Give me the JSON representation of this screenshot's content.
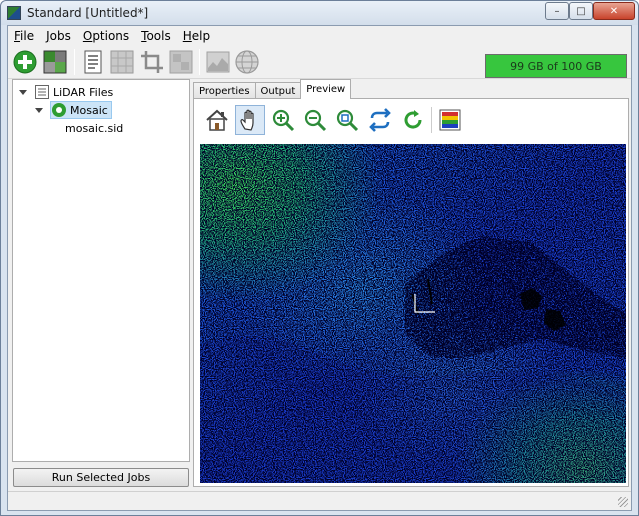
{
  "window": {
    "title": "Standard [Untitled*]",
    "buttons": {
      "minimize": "–",
      "maximize": "□",
      "close": "✕"
    }
  },
  "menubar": {
    "items": [
      {
        "label": "File",
        "accel": "F",
        "rest": "ile"
      },
      {
        "label": "Jobs",
        "accel": "J",
        "rest": "obs"
      },
      {
        "label": "Options",
        "accel": "O",
        "rest": "ptions"
      },
      {
        "label": "Tools",
        "accel": "T",
        "rest": "ools"
      },
      {
        "label": "Help",
        "accel": "H",
        "rest": "elp"
      }
    ]
  },
  "toolbar": {
    "icons": [
      "add-icon",
      "mosaic-icon",
      "document-icon",
      "grid-icon",
      "crop-icon",
      "tiles-icon",
      "chart-icon",
      "globe-icon"
    ],
    "storage": {
      "label": "99 GB of 100 GB",
      "used_fraction": 0.99,
      "color": "#37c63e"
    }
  },
  "tree": {
    "root": {
      "label": "LiDAR Files"
    },
    "child": {
      "label": "Mosaic"
    },
    "leaf": {
      "label": "mosaic.sid"
    }
  },
  "left_panel": {
    "run_button": "Run Selected Jobs"
  },
  "tabs": [
    {
      "label": "Properties",
      "active": false
    },
    {
      "label": "Output",
      "active": false
    },
    {
      "label": "Preview",
      "active": true
    }
  ],
  "preview_toolbar": {
    "icons": [
      "home-icon",
      "pan-hand-icon",
      "zoom-in-icon",
      "zoom-out-icon",
      "zoom-fit-icon",
      "swap-icon",
      "refresh-icon",
      "color-ramp-icon"
    ],
    "pressed": "pan-hand-icon"
  },
  "colors": {
    "lidar_blue": "#1a3ed0",
    "lidar_green": "#2fcf55",
    "lidar_cyan": "#1c9ae0",
    "accent_green": "#2e9d32"
  }
}
